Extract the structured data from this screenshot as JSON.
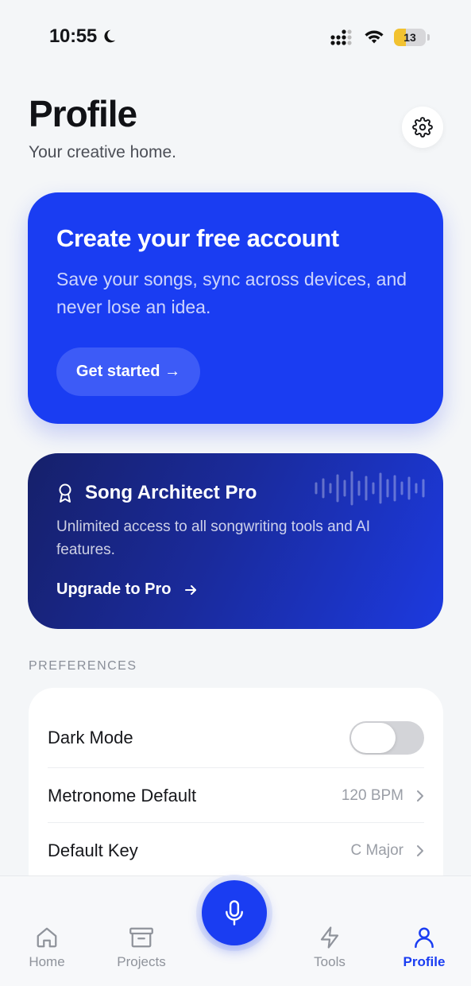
{
  "status_bar": {
    "time": "10:55",
    "battery": "13"
  },
  "header": {
    "title": "Profile",
    "subtitle": "Your creative home."
  },
  "account_card": {
    "title": "Create your free account",
    "description": "Save your songs, sync across devices, and never lose an idea.",
    "cta_label": "Get started →"
  },
  "pro_card": {
    "title": "Song Architect Pro",
    "description": "Unlimited access to all songwriting tools and AI features.",
    "link_label": "Upgrade to Pro"
  },
  "preferences": {
    "section_label": "PREFERENCES",
    "items": [
      {
        "label": "Dark Mode",
        "toggle_on": false
      },
      {
        "label": "Metronome Default",
        "value": "120 BPM"
      },
      {
        "label": "Default Key",
        "value": "C Major"
      }
    ]
  },
  "tab_bar": {
    "tabs": [
      {
        "label": "Home",
        "icon": "home-icon"
      },
      {
        "label": "Projects",
        "icon": "archive-icon"
      },
      {
        "label": "Tools",
        "icon": "bolt-icon"
      },
      {
        "label": "Profile",
        "icon": "user-icon",
        "active": true
      }
    ],
    "center_icon": "microphone-icon"
  },
  "colors": {
    "accent": "#1a3df2",
    "background": "#f4f6f8"
  }
}
